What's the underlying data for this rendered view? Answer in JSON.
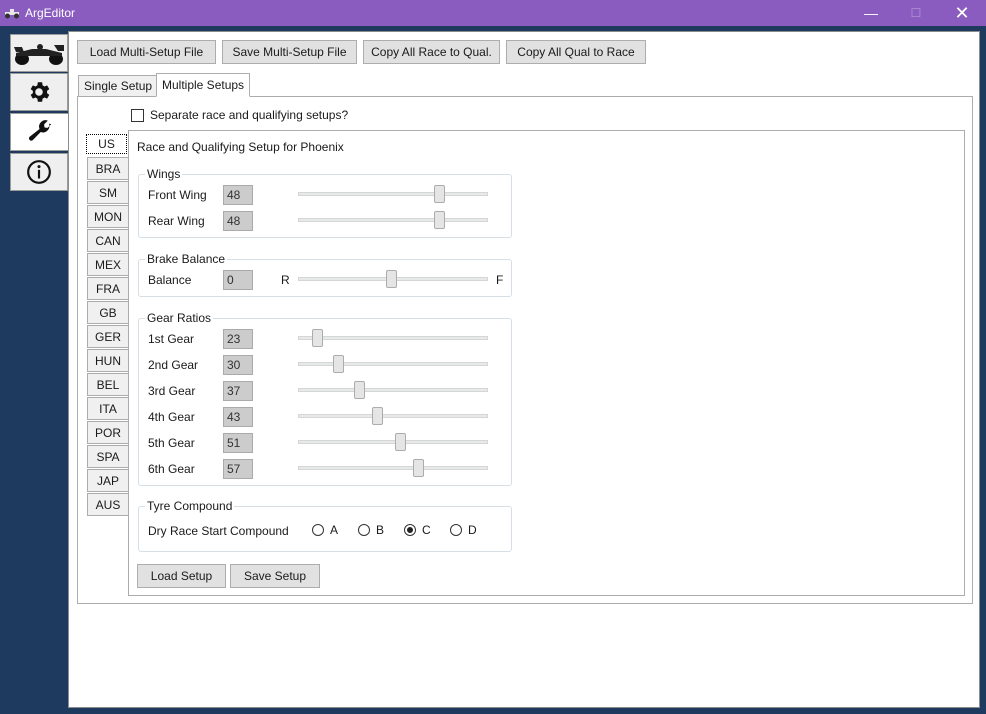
{
  "window": {
    "title": "ArgEditor",
    "minimize_glyph": "—",
    "maximize_glyph": "☐",
    "close_glyph": "✕"
  },
  "sidenav": [
    {
      "name": "car-icon"
    },
    {
      "name": "gear-icon"
    },
    {
      "name": "wrench-icon",
      "active": true
    },
    {
      "name": "info-icon"
    }
  ],
  "toolbar": {
    "load_multi": "Load Multi-Setup File",
    "save_multi": "Save Multi-Setup File",
    "copy_race_to_qual": "Copy All Race to Qual.",
    "copy_qual_to_race": "Copy All Qual to Race"
  },
  "tabs": {
    "single": "Single Setup",
    "multiple": "Multiple Setups"
  },
  "separate_checkbox": {
    "label": "Separate race and qualifying setups?",
    "checked": false
  },
  "tracks": [
    "US",
    "BRA",
    "SM",
    "MON",
    "CAN",
    "MEX",
    "FRA",
    "GB",
    "GER",
    "HUN",
    "BEL",
    "ITA",
    "POR",
    "SPA",
    "JAP",
    "AUS"
  ],
  "setup": {
    "heading": "Race and Qualifying Setup for Phoenix",
    "wings": {
      "title": "Wings",
      "front": {
        "label": "Front Wing",
        "value": "48"
      },
      "rear": {
        "label": "Rear Wing",
        "value": "48"
      }
    },
    "brake": {
      "title": "Brake Balance",
      "label": "Balance",
      "value": "0",
      "left_mark": "R",
      "right_mark": "F"
    },
    "gears": {
      "title": "Gear Ratios",
      "items": [
        {
          "label": "1st Gear",
          "value": "23"
        },
        {
          "label": "2nd Gear",
          "value": "30"
        },
        {
          "label": "3rd Gear",
          "value": "37"
        },
        {
          "label": "4th Gear",
          "value": "43"
        },
        {
          "label": "5th Gear",
          "value": "51"
        },
        {
          "label": "6th Gear",
          "value": "57"
        }
      ]
    },
    "tyre": {
      "title": "Tyre Compound",
      "label": "Dry Race Start Compound",
      "options": [
        "A",
        "B",
        "C",
        "D"
      ],
      "selected": "C"
    },
    "load_button": "Load Setup",
    "save_button": "Save Setup"
  }
}
